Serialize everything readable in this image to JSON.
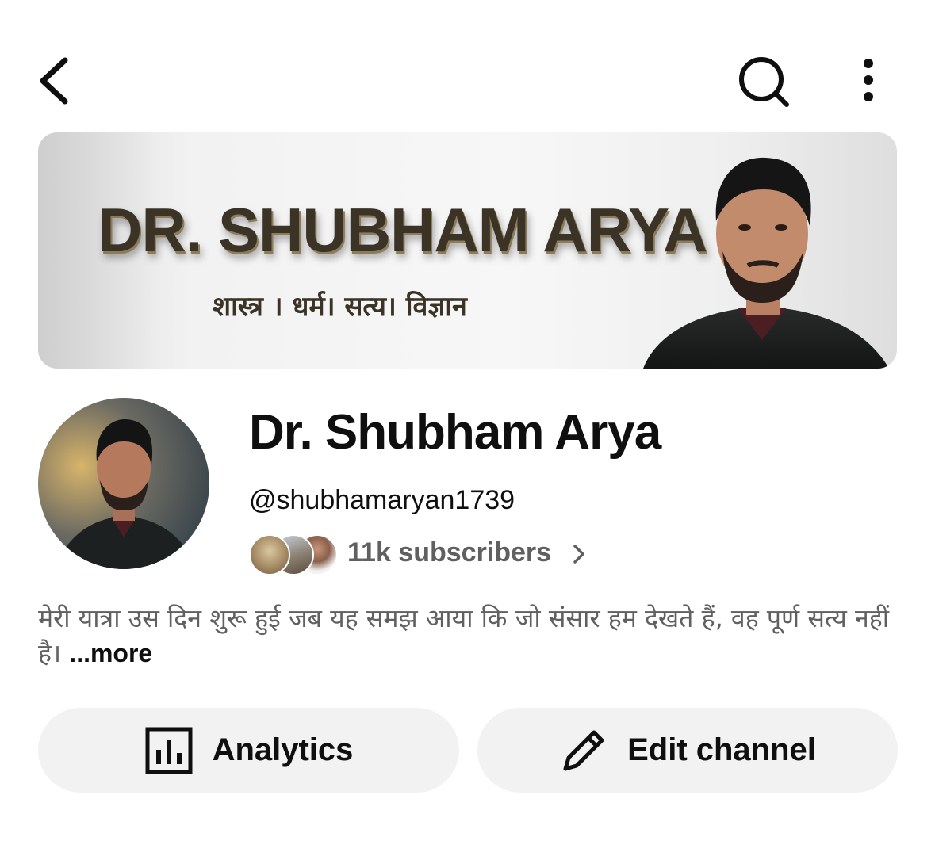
{
  "topbar": {
    "back_icon": "back-chevron-icon",
    "search_icon": "search-icon",
    "more_icon": "more-vert-icon"
  },
  "banner": {
    "title": "DR. SHUBHAM ARYA",
    "subtitle": "शास्त्र । धर्म। सत्य। विज्ञान"
  },
  "channel": {
    "name": "Dr. Shubham Arya",
    "handle": "@shubhamaryan1739",
    "subscribers": "11k subscribers",
    "description": "मेरी यात्रा उस दिन शुरू हुई जब यह समझ आया कि जो संसार हम देखते हैं, वह पूर्ण सत्य नहीं है।",
    "more_label": "...more"
  },
  "actions": {
    "analytics_label": "Analytics",
    "analytics_icon": "analytics-bar-chart-icon",
    "edit_label": "Edit channel",
    "edit_icon": "pencil-icon"
  },
  "colors": {
    "background": "#ffffff",
    "text_primary": "#0f0f0f",
    "text_secondary": "#606060",
    "button_bg": "#f2f2f2"
  }
}
